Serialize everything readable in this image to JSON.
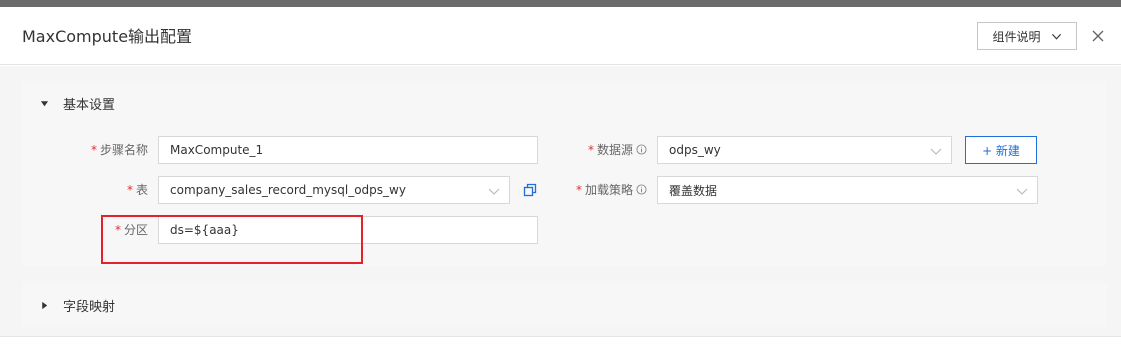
{
  "dialog": {
    "title": "MaxCompute输出配置",
    "help_button_label": "组件说明"
  },
  "basic_section": {
    "title": "基本设置",
    "fields": {
      "step_name": {
        "label": "步骤名称",
        "value": "MaxCompute_1"
      },
      "table": {
        "label": "表",
        "value": "company_sales_record_mysql_odps_wy"
      },
      "partition": {
        "label": "分区",
        "value": "ds=${aaa}"
      },
      "datasource": {
        "label": "数据源",
        "value": "odps_wy"
      },
      "load_strategy": {
        "label": "加载策略",
        "value": "覆盖数据"
      }
    },
    "new_button_label": "+ 新建",
    "required_mark": "*"
  },
  "mapping_section": {
    "title": "字段映射"
  },
  "colors": {
    "accent": "#1e6fd9",
    "required": "#e03030",
    "highlight": "#e8202a"
  }
}
